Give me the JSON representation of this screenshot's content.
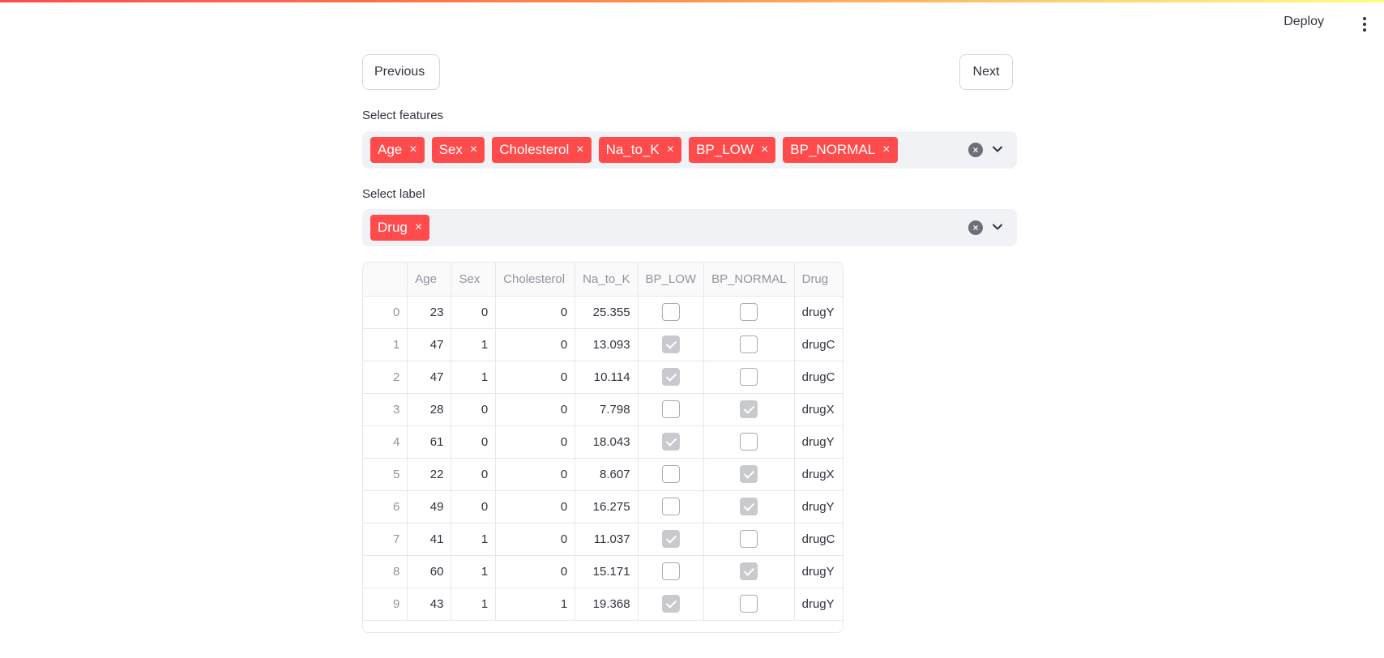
{
  "header": {
    "deploy_label": "Deploy",
    "menu_icon": "kebab-menu-icon"
  },
  "nav": {
    "previous_label": "Previous",
    "next_label": "Next"
  },
  "features": {
    "label": "Select features",
    "selected": [
      "Age",
      "Sex",
      "Cholesterol",
      "Na_to_K",
      "BP_LOW",
      "BP_NORMAL"
    ]
  },
  "label_select": {
    "label": "Select label",
    "selected": [
      "Drug"
    ]
  },
  "table": {
    "columns": [
      "",
      "Age",
      "Sex",
      "Cholesterol",
      "Na_to_K",
      "BP_LOW",
      "BP_NORMAL",
      "Drug"
    ],
    "rows": [
      [
        "0",
        "23",
        "0",
        "0",
        "25.355",
        false,
        false,
        "drugY"
      ],
      [
        "1",
        "47",
        "1",
        "0",
        "13.093",
        true,
        false,
        "drugC"
      ],
      [
        "2",
        "47",
        "1",
        "0",
        "10.114",
        true,
        false,
        "drugC"
      ],
      [
        "3",
        "28",
        "0",
        "0",
        "7.798",
        false,
        true,
        "drugX"
      ],
      [
        "4",
        "61",
        "0",
        "0",
        "18.043",
        true,
        false,
        "drugY"
      ],
      [
        "5",
        "22",
        "0",
        "0",
        "8.607",
        false,
        true,
        "drugX"
      ],
      [
        "6",
        "49",
        "0",
        "0",
        "16.275",
        false,
        true,
        "drugY"
      ],
      [
        "7",
        "41",
        "1",
        "0",
        "11.037",
        true,
        false,
        "drugC"
      ],
      [
        "8",
        "60",
        "1",
        "0",
        "15.171",
        false,
        true,
        "drugY"
      ],
      [
        "9",
        "43",
        "1",
        "1",
        "19.368",
        true,
        false,
        "drugY"
      ]
    ]
  },
  "colors": {
    "accent": "#ff4b4b",
    "select_bg": "#f0f2f6"
  }
}
